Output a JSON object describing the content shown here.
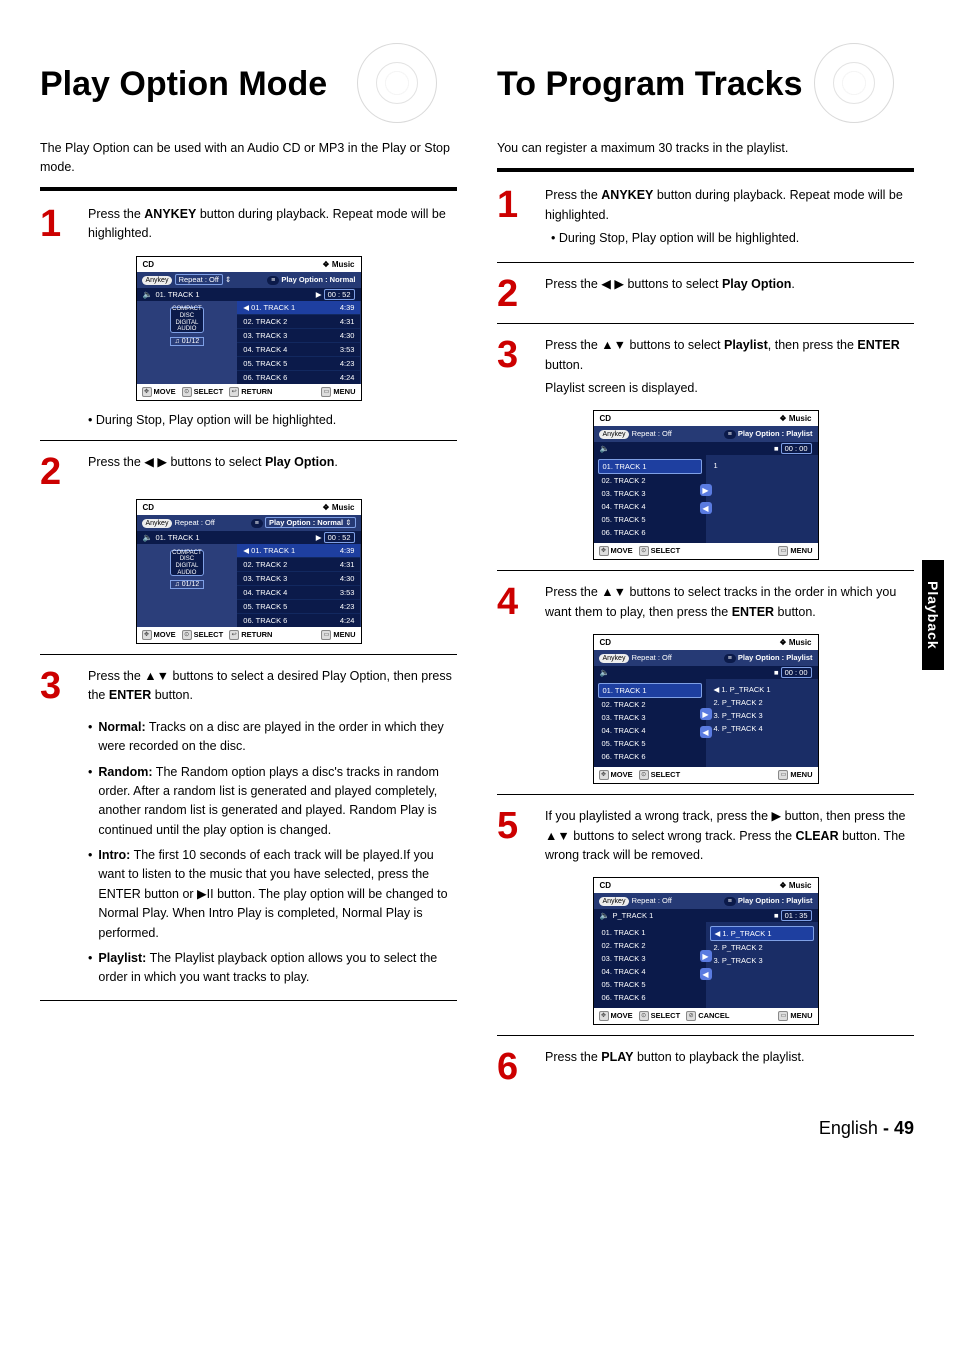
{
  "sideTab": "Playback",
  "pageLang": "English",
  "pageNum": "49",
  "left": {
    "title": "Play Option Mode",
    "lead": "The Play Option can be used with an Audio CD or MP3 in the Play or Stop mode.",
    "step1": {
      "a": "Press the ",
      "b": "ANYKEY",
      "c": " button during playback. Repeat mode will be highlighted."
    },
    "note1": "• During Stop, Play option will be highlighted.",
    "step2": {
      "a": "Press the ◀ ▶ buttons to select ",
      "b": "Play Option",
      "c": "."
    },
    "step3": {
      "a": "Press the ▲▼ buttons to select a desired Play Option, then press the ",
      "b": "ENTER",
      "c": " button."
    },
    "bul": {
      "normal_l": "Normal:",
      "normal_t": " Tracks on a disc are played in the order in which they were recorded on the disc.",
      "random_l": "Random:",
      "random_t": " The Random option plays a disc's tracks in random order. After a random list is generated and played completely, another random list is generated and played. Random Play is continued until the play option is changed.",
      "intro_l": "Intro:",
      "intro_t": " The first 10 seconds of each track will be played.If you want to listen to the music that you have selected, press the ENTER button or ▶II button. The play option will be changed to Normal Play. When Intro Play is completed, Normal Play is performed.",
      "playlist_l": "Playlist:",
      "playlist_t": " The Playlist playback option allows you to select the order in which you want tracks to play."
    },
    "shot1": {
      "headL": "CD",
      "headR": "❖ Music",
      "anykey": "Anykey",
      "repeat": "Repeat : Off",
      "opt": "Play Option : Normal",
      "nowTrack": "01. TRACK 1",
      "nowTime": "00 : 52",
      "leftTag": "01/12",
      "leftDisc": "COMPACT DISC DIGITAL AUDIO",
      "tracks": [
        [
          "01. TRACK 1",
          "4:39"
        ],
        [
          "02. TRACK 2",
          "4:31"
        ],
        [
          "03. TRACK 3",
          "4:30"
        ],
        [
          "04. TRACK 4",
          "3:53"
        ],
        [
          "05. TRACK 5",
          "4:23"
        ],
        [
          "06. TRACK 6",
          "4:24"
        ]
      ],
      "foot": [
        "MOVE",
        "SELECT",
        "RETURN",
        "MENU"
      ]
    },
    "shot2": {
      "headL": "CD",
      "headR": "❖ Music",
      "anykey": "Anykey",
      "repeat": "Repeat : Off",
      "opt": "Play Option : Normal",
      "nowTrack": "01. TRACK 1",
      "nowTime": "00 : 52",
      "leftTag": "01/12",
      "leftDisc": "COMPACT DISC DIGITAL AUDIO",
      "tracks": [
        [
          "01. TRACK 1",
          "4:39"
        ],
        [
          "02. TRACK 2",
          "4:31"
        ],
        [
          "03. TRACK 3",
          "4:30"
        ],
        [
          "04. TRACK 4",
          "3:53"
        ],
        [
          "05. TRACK 5",
          "4:23"
        ],
        [
          "06. TRACK 6",
          "4:24"
        ]
      ],
      "foot": [
        "MOVE",
        "SELECT",
        "RETURN",
        "MENU"
      ]
    }
  },
  "right": {
    "title": "To Program Tracks",
    "lead": "You can register a maximum 30 tracks in the playlist.",
    "step1": {
      "a": "Press the ",
      "b": "ANYKEY",
      "c": " button during playback. Repeat mode will be highlighted.",
      "sub": "• During Stop, Play option will be highlighted."
    },
    "step2": {
      "a": "Press the ◀ ▶ buttons to select ",
      "b": "Play Option",
      "c": "."
    },
    "step3": {
      "a": "Press the ▲▼ buttons to select ",
      "b": "Playlist",
      "c": ", then press the ",
      "d": "ENTER",
      "e": " button.",
      "f": "Playlist screen is displayed."
    },
    "step4": {
      "a": "Press the ▲▼ buttons to select tracks in the order in which you want them to play, then press the ",
      "b": "ENTER",
      "c": " button."
    },
    "step5": {
      "a": "If you playlisted a wrong track, press the ▶ button, then press the ▲▼ buttons to select wrong track. Press the ",
      "b": "CLEAR",
      "c": " button. The wrong track will be removed."
    },
    "step6": {
      "a": "Press the ",
      "b": "PLAY",
      "c": " button to playback the playlist."
    },
    "plshot3": {
      "headL": "CD",
      "headR": "❖ Music",
      "anykey": "Anykey",
      "repeat": "Repeat : Off",
      "opt": "Play Option : Playlist",
      "nowTrack": "",
      "nowTime": "00 : 00",
      "left": [
        "01. TRACK 1",
        "02. TRACK 2",
        "03. TRACK 3",
        "04. TRACK 4",
        "05. TRACK 5",
        "06. TRACK 6"
      ],
      "right": [
        "1"
      ],
      "foot": [
        "MOVE",
        "SELECT",
        "MENU"
      ]
    },
    "plshot4": {
      "headL": "CD",
      "headR": "❖ Music",
      "anykey": "Anykey",
      "repeat": "Repeat : Off",
      "opt": "Play Option : Playlist",
      "nowTrack": "",
      "nowTime": "00 : 00",
      "left": [
        "01. TRACK 1",
        "02. TRACK 2",
        "03. TRACK 3",
        "04. TRACK 4",
        "05. TRACK 5",
        "06. TRACK 6"
      ],
      "right": [
        "1. P_TRACK 1",
        "2. P_TRACK 2",
        "3. P_TRACK 3",
        "4. P_TRACK 4"
      ],
      "foot": [
        "MOVE",
        "SELECT",
        "MENU"
      ]
    },
    "plshot5": {
      "headL": "CD",
      "headR": "❖ Music",
      "anykey": "Anykey",
      "repeat": "Repeat : Off",
      "opt": "Play Option : Playlist",
      "nowTrack": "P_TRACK 1",
      "nowTime": "01 : 35",
      "left": [
        "01. TRACK 1",
        "02. TRACK 2",
        "03. TRACK 3",
        "04. TRACK 4",
        "05. TRACK 5",
        "06. TRACK 6"
      ],
      "right": [
        "1. P_TRACK 1",
        "2. P_TRACK 2",
        "3. P_TRACK 3"
      ],
      "foot": [
        "MOVE",
        "SELECT",
        "CANCEL",
        "MENU"
      ]
    }
  }
}
